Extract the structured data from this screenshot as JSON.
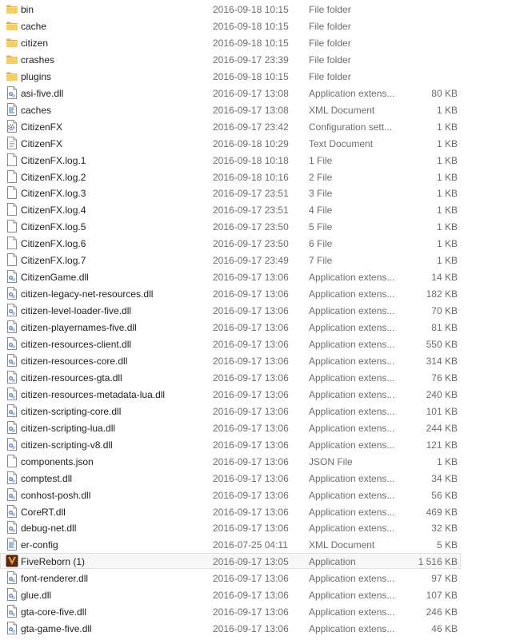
{
  "files": [
    {
      "name": "bin",
      "date": "2016-09-18 10:15",
      "type": "File folder",
      "size": "",
      "icon": "folder-icon"
    },
    {
      "name": "cache",
      "date": "2016-09-18 10:15",
      "type": "File folder",
      "size": "",
      "icon": "folder-icon"
    },
    {
      "name": "citizen",
      "date": "2016-09-18 10:15",
      "type": "File folder",
      "size": "",
      "icon": "folder-icon"
    },
    {
      "name": "crashes",
      "date": "2016-09-17 23:39",
      "type": "File folder",
      "size": "",
      "icon": "folder-icon"
    },
    {
      "name": "plugins",
      "date": "2016-09-18 10:15",
      "type": "File folder",
      "size": "",
      "icon": "folder-icon"
    },
    {
      "name": "asi-five.dll",
      "date": "2016-09-17 13:08",
      "type": "Application extens...",
      "size": "80 KB",
      "icon": "dll-file-icon"
    },
    {
      "name": "caches",
      "date": "2016-09-17 13:08",
      "type": "XML Document",
      "size": "1 KB",
      "icon": "xml-file-icon"
    },
    {
      "name": "CitizenFX",
      "date": "2016-09-17 23:42",
      "type": "Configuration sett...",
      "size": "1 KB",
      "icon": "config-file-icon"
    },
    {
      "name": "CitizenFX",
      "date": "2016-09-18 10:29",
      "type": "Text Document",
      "size": "1 KB",
      "icon": "text-file-icon"
    },
    {
      "name": "CitizenFX.log.1",
      "date": "2016-09-18 10:18",
      "type": "1 File",
      "size": "1 KB",
      "icon": "blank-file-icon"
    },
    {
      "name": "CitizenFX.log.2",
      "date": "2016-09-18 10:16",
      "type": "2 File",
      "size": "1 KB",
      "icon": "blank-file-icon"
    },
    {
      "name": "CitizenFX.log.3",
      "date": "2016-09-17 23:51",
      "type": "3 File",
      "size": "1 KB",
      "icon": "blank-file-icon"
    },
    {
      "name": "CitizenFX.log.4",
      "date": "2016-09-17 23:51",
      "type": "4 File",
      "size": "1 KB",
      "icon": "blank-file-icon"
    },
    {
      "name": "CitizenFX.log.5",
      "date": "2016-09-17 23:50",
      "type": "5 File",
      "size": "1 KB",
      "icon": "blank-file-icon"
    },
    {
      "name": "CitizenFX.log.6",
      "date": "2016-09-17 23:50",
      "type": "6 File",
      "size": "1 KB",
      "icon": "blank-file-icon"
    },
    {
      "name": "CitizenFX.log.7",
      "date": "2016-09-17 23:49",
      "type": "7 File",
      "size": "1 KB",
      "icon": "blank-file-icon"
    },
    {
      "name": "CitizenGame.dll",
      "date": "2016-09-17 13:06",
      "type": "Application extens...",
      "size": "14 KB",
      "icon": "dll-file-icon"
    },
    {
      "name": "citizen-legacy-net-resources.dll",
      "date": "2016-09-17 13:06",
      "type": "Application extens...",
      "size": "182 KB",
      "icon": "dll-file-icon"
    },
    {
      "name": "citizen-level-loader-five.dll",
      "date": "2016-09-17 13:06",
      "type": "Application extens...",
      "size": "70 KB",
      "icon": "dll-file-icon"
    },
    {
      "name": "citizen-playernames-five.dll",
      "date": "2016-09-17 13:06",
      "type": "Application extens...",
      "size": "81 KB",
      "icon": "dll-file-icon"
    },
    {
      "name": "citizen-resources-client.dll",
      "date": "2016-09-17 13:06",
      "type": "Application extens...",
      "size": "550 KB",
      "icon": "dll-file-icon"
    },
    {
      "name": "citizen-resources-core.dll",
      "date": "2016-09-17 13:06",
      "type": "Application extens...",
      "size": "314 KB",
      "icon": "dll-file-icon"
    },
    {
      "name": "citizen-resources-gta.dll",
      "date": "2016-09-17 13:06",
      "type": "Application extens...",
      "size": "76 KB",
      "icon": "dll-file-icon"
    },
    {
      "name": "citizen-resources-metadata-lua.dll",
      "date": "2016-09-17 13:06",
      "type": "Application extens...",
      "size": "240 KB",
      "icon": "dll-file-icon"
    },
    {
      "name": "citizen-scripting-core.dll",
      "date": "2016-09-17 13:06",
      "type": "Application extens...",
      "size": "101 KB",
      "icon": "dll-file-icon"
    },
    {
      "name": "citizen-scripting-lua.dll",
      "date": "2016-09-17 13:06",
      "type": "Application extens...",
      "size": "244 KB",
      "icon": "dll-file-icon"
    },
    {
      "name": "citizen-scripting-v8.dll",
      "date": "2016-09-17 13:06",
      "type": "Application extens...",
      "size": "121 KB",
      "icon": "dll-file-icon"
    },
    {
      "name": "components.json",
      "date": "2016-09-17 13:06",
      "type": "JSON File",
      "size": "1 KB",
      "icon": "blank-file-icon"
    },
    {
      "name": "comptest.dll",
      "date": "2016-09-17 13:06",
      "type": "Application extens...",
      "size": "34 KB",
      "icon": "dll-file-icon"
    },
    {
      "name": "conhost-posh.dll",
      "date": "2016-09-17 13:06",
      "type": "Application extens...",
      "size": "56 KB",
      "icon": "dll-file-icon"
    },
    {
      "name": "CoreRT.dll",
      "date": "2016-09-17 13:06",
      "type": "Application extens...",
      "size": "469 KB",
      "icon": "dll-file-icon"
    },
    {
      "name": "debug-net.dll",
      "date": "2016-09-17 13:06",
      "type": "Application extens...",
      "size": "32 KB",
      "icon": "dll-file-icon"
    },
    {
      "name": "er-config",
      "date": "2016-07-25 04:11",
      "type": "XML Document",
      "size": "5 KB",
      "icon": "xml-file-icon"
    },
    {
      "name": "FiveReborn (1)",
      "date": "2016-09-17 13:05",
      "type": "Application",
      "size": "1 516 KB",
      "icon": "fivereborn-app-icon",
      "selected": true
    },
    {
      "name": "font-renderer.dll",
      "date": "2016-09-17 13:06",
      "type": "Application extens...",
      "size": "97 KB",
      "icon": "dll-file-icon"
    },
    {
      "name": "glue.dll",
      "date": "2016-09-17 13:06",
      "type": "Application extens...",
      "size": "107 KB",
      "icon": "dll-file-icon"
    },
    {
      "name": "gta-core-five.dll",
      "date": "2016-09-17 13:06",
      "type": "Application extens...",
      "size": "246 KB",
      "icon": "dll-file-icon"
    },
    {
      "name": "gta-game-five.dll",
      "date": "2016-09-17 13:06",
      "type": "Application extens...",
      "size": "46 KB",
      "icon": "dll-file-icon"
    }
  ]
}
